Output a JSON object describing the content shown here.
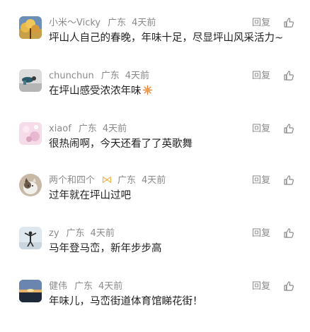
{
  "comments": [
    {
      "nick": "小米～Vicky",
      "location": "广东",
      "time": "4天前",
      "text": "坪山人自己的春晚，年味十足，尽显坪山风采活力~",
      "reply": "回复",
      "decor": "",
      "emoji": ""
    },
    {
      "nick": "chunchun",
      "location": "广东",
      "time": "4天前",
      "text": "在坪山感受浓浓年味",
      "reply": "回复",
      "decor": "",
      "emoji": "fireworks-icon"
    },
    {
      "nick": "xiaof",
      "location": "广东",
      "time": "4天前",
      "text": "很热闹啊，今天还看了了英歌舞",
      "reply": "回复",
      "decor": "",
      "emoji": ""
    },
    {
      "nick": "两个和四个",
      "location": "广东",
      "time": "4天前",
      "text": "过年就在坪山过吧",
      "reply": "回复",
      "decor": "bow-icon",
      "emoji": ""
    },
    {
      "nick": "zy",
      "location": "广东",
      "time": "4天前",
      "text": "马年登马峦，新年步步高",
      "reply": "回复",
      "decor": "",
      "emoji": ""
    },
    {
      "nick": "健伟",
      "location": "广东",
      "time": "4天前",
      "text": "年味儿，马峦街道体育馆睇花街！",
      "reply": "回复",
      "decor": "",
      "emoji": ""
    }
  ],
  "colors": {
    "text": "#1f1f1f",
    "meta": "#8a8a8a",
    "bow": "#f1b44c",
    "firework": "#e8782a"
  }
}
